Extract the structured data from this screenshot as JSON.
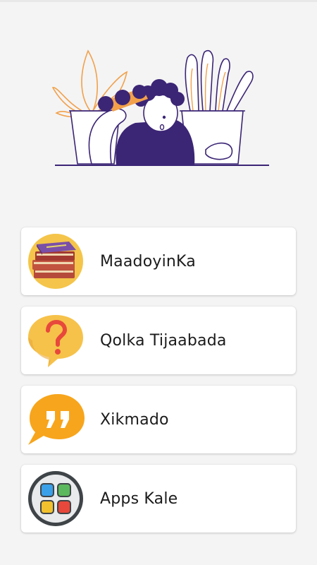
{
  "menu": {
    "items": [
      {
        "label": "MaadoyinKa",
        "icon": "books-icon"
      },
      {
        "label": "Qolka Tijaabada",
        "icon": "question-bubble-icon"
      },
      {
        "label": "Xikmado",
        "icon": "quote-bubble-icon"
      },
      {
        "label": "Apps Kale",
        "icon": "apps-grid-icon"
      }
    ]
  },
  "colors": {
    "background": "#f4f4f4",
    "card": "#ffffff",
    "accent_purple": "#3b2575",
    "accent_orange": "#f29a35",
    "bubble_yellow": "#f6c24a"
  }
}
